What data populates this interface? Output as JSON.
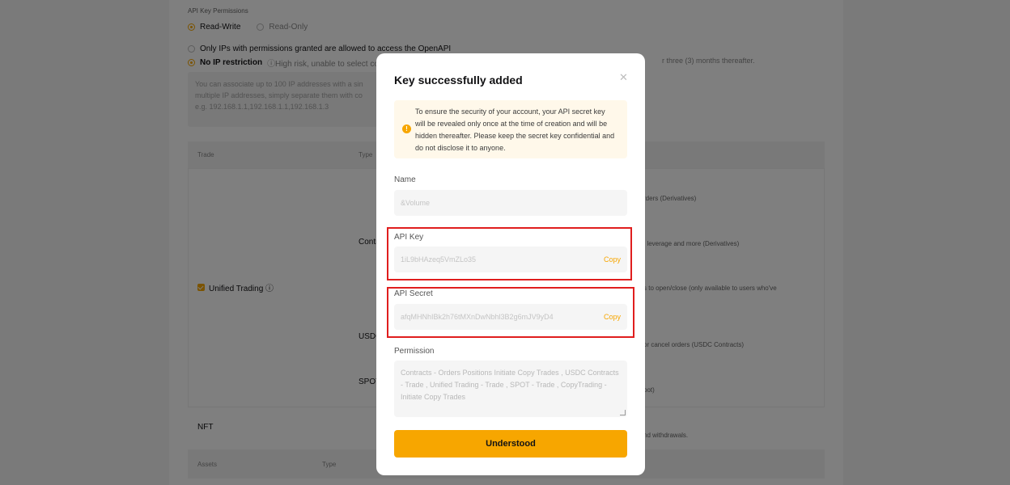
{
  "background": {
    "permissions_title": "API Key Permissions",
    "radio_read_write": "Read-Write",
    "radio_read_only": "Read-Only",
    "ip_option_restricted": "Only IPs with permissions granted are allowed to access the OpenAPI",
    "ip_option_none": "No IP restriction",
    "ip_none_note": "ⓘHigh risk, unable to select coi",
    "ip_right_note": "r three (3) months thereafter.",
    "ip_box_text": "You can associate up to 100 IP addresses with a sin\nmultiple IP addresses, simply separate them with co\ne.g. 192.168.1.1,192.168.1.1,192.168.1.3",
    "table_head_trade": "Trade",
    "table_head_type": "Type",
    "unified_trading": "Unified Trading ⓘ",
    "row_contracts_partial": "Contr",
    "row_usdc_partial": "USDC",
    "row_spot_partial": "SPOT",
    "right_texts": [
      "rders (Derivatives)",
      ", leverage and more (Derivatives)",
      "s to open/close (only available to users who've",
      "or cancel orders (USDC Contracts)",
      "pot)",
      "nd withdrawals."
    ],
    "nft": "NFT",
    "assets_head_assets": "Assets",
    "assets_head_type": "Type"
  },
  "modal": {
    "title": "Key successfully added",
    "notice": "To ensure the security of your account, your API secret key will be revealed only once at the time of creation and will be hidden thereafter. Please keep the secret key confidential and do not disclose it to anyone.",
    "name_label": "Name",
    "name_value": "&Volume",
    "api_key_label": "API Key",
    "api_key_value": "1iL9bHAzeq5VmZLo35",
    "api_secret_label": "API Secret",
    "api_secret_value": "afqMHNhIBk2h76tMXnDwNbhl3B2g6mJV9yD4",
    "copy_label": "Copy",
    "permission_label": "Permission",
    "permission_value": "Contracts - Orders Positions Initiate Copy Trades , USDC Contracts - Trade , Unified Trading - Trade , SPOT - Trade , CopyTrading - Initiate Copy Trades",
    "understood_label": "Understood"
  },
  "colors": {
    "accent": "#f7a600",
    "highlight_box": "#e01e1e"
  }
}
